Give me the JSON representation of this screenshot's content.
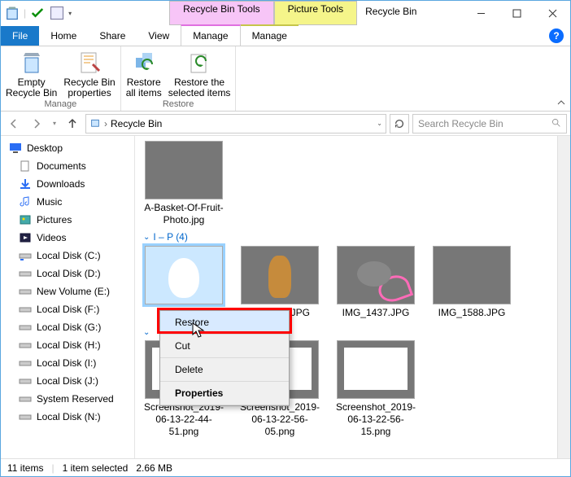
{
  "window": {
    "title": "Recycle Bin"
  },
  "tool_tabs": {
    "recycle": "Recycle Bin Tools",
    "picture": "Picture Tools"
  },
  "tabs": {
    "file": "File",
    "home": "Home",
    "share": "Share",
    "view": "View",
    "manage1": "Manage",
    "manage2": "Manage"
  },
  "ribbon": {
    "empty": "Empty\nRecycle Bin",
    "properties": "Recycle Bin\nproperties",
    "restore_all": "Restore\nall items",
    "restore_selected": "Restore the\nselected items",
    "group_manage": "Manage",
    "group_restore": "Restore"
  },
  "address": {
    "path": "Recycle Bin"
  },
  "search": {
    "placeholder": "Search Recycle Bin"
  },
  "sidebar": {
    "items": [
      "Desktop",
      "Documents",
      "Downloads",
      "Music",
      "Pictures",
      "Videos",
      "Local Disk (C:)",
      "Local Disk (D:)",
      "New Volume (E:)",
      "Local Disk (F:)",
      "Local Disk (G:)",
      "Local Disk (H:)",
      "Local Disk (I:)",
      "Local Disk (J:)",
      "System Reserved",
      "Local Disk (N:)"
    ]
  },
  "groups": {
    "g0_file": "A-Basket-Of-Fruit-Photo.jpg",
    "g1_head": "I – P (4)",
    "g1_files": {
      "f2": "02.JPG",
      "f3": "IMG_1437.JPG",
      "f4": "IMG_1588.JPG"
    },
    "g2_files": {
      "s1": "Screenshot_2019-06-13-22-44-51.png",
      "s2": "Screenshot_2019-06-13-22-56-05.png",
      "s3": "Screenshot_2019-06-13-22-56-15.png"
    }
  },
  "context_menu": {
    "restore": "Restore",
    "cut": "Cut",
    "delete": "Delete",
    "properties": "Properties"
  },
  "status": {
    "count": "11 items",
    "selected": "1 item selected",
    "size": "2.66 MB"
  }
}
